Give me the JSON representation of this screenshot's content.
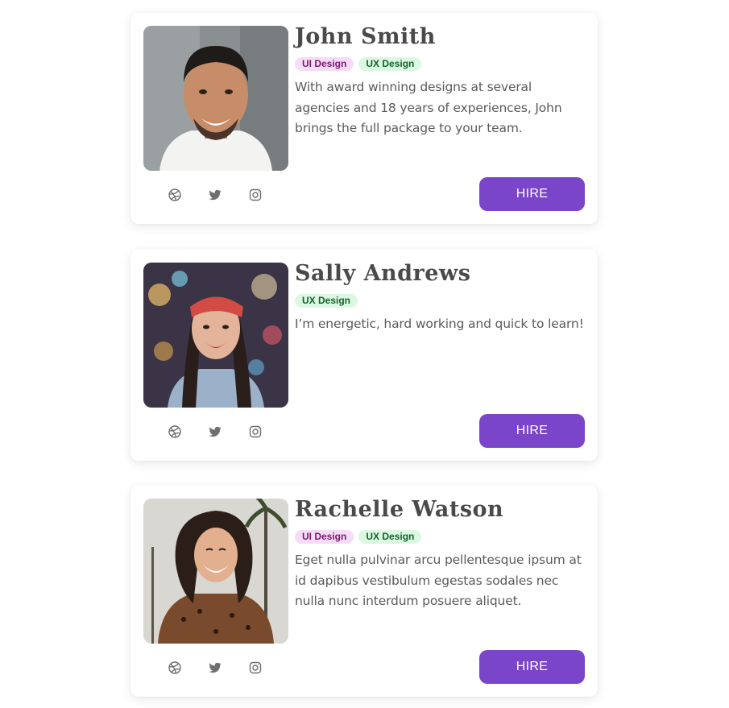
{
  "cards": [
    {
      "name": "John Smith",
      "tags": [
        "UI Design",
        "UX Design"
      ],
      "bio": "With award winning designs at several agencies and 18 years of experiences, John brings the full package to your team.",
      "hire_label": "HIRE",
      "photo": "portrait-man-smiling"
    },
    {
      "name": "Sally Andrews",
      "tags": [
        "UX Design"
      ],
      "bio": "I’m energetic, hard working and quick to learn!",
      "hire_label": "HIRE",
      "photo": "portrait-woman-headband"
    },
    {
      "name": "Rachelle Watson",
      "tags": [
        "UI Design",
        "UX Design"
      ],
      "bio": "Eget nulla pulvinar arcu pellentesque ipsum at id dapibus vestibulum egestas sodales nec nulla nunc interdum posuere aliquet.",
      "hire_label": "HIRE",
      "photo": "portrait-woman-laughing"
    }
  ],
  "social_icons": [
    "dribbble-icon",
    "twitter-icon",
    "instagram-icon"
  ],
  "colors": {
    "accent": "#7b45c9",
    "ui_tag_bg": "#f6dcf6",
    "ui_tag_text": "#7a1b6e",
    "ux_tag_bg": "#dbf8e2",
    "ux_tag_text": "#16612a"
  }
}
